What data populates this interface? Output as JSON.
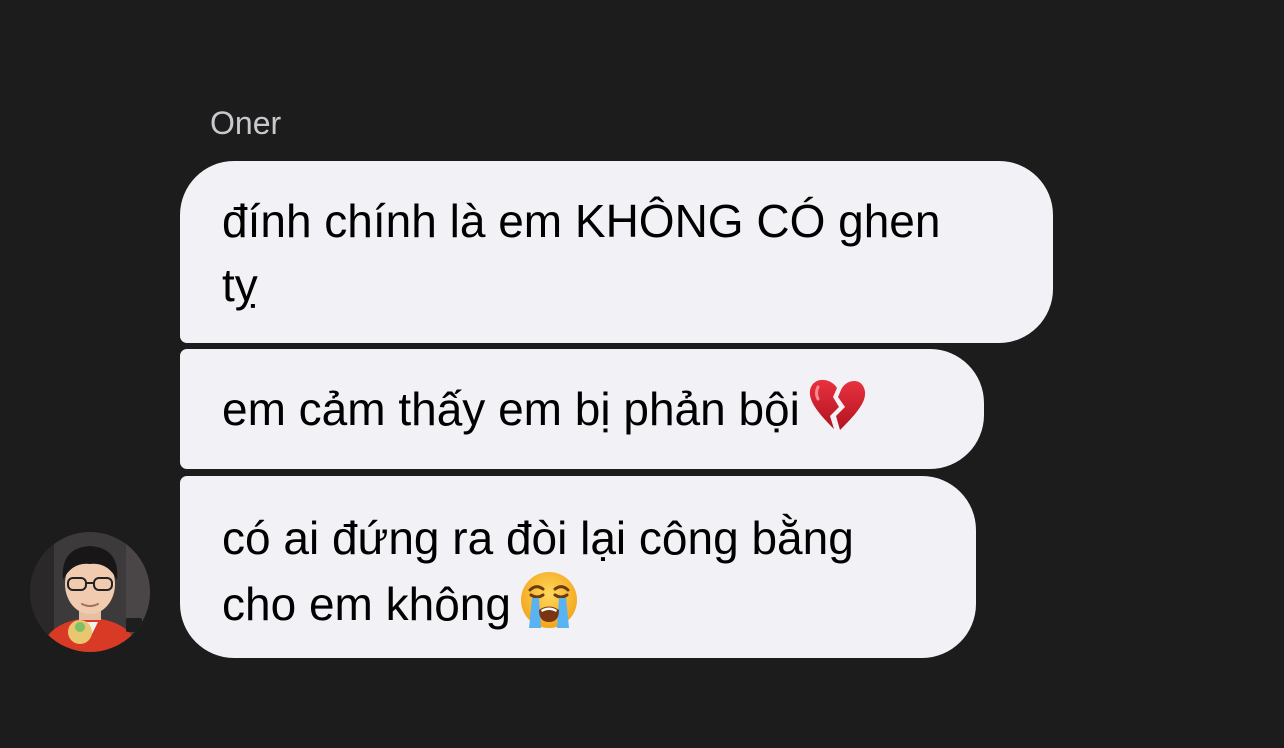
{
  "conversation": {
    "sender_name": "Oner",
    "messages": [
      {
        "lines": [
          "đính chính là em KHÔNG CÓ ghen",
          "tỵ"
        ]
      },
      {
        "lines": [
          "em cảm thấy em bị phản bội"
        ],
        "emoji": "broken-heart-icon"
      },
      {
        "lines": [
          "có ai đứng ra đòi lại công bằng",
          "cho em không"
        ],
        "emoji": "loudly-crying-face-icon"
      }
    ]
  },
  "colors": {
    "background": "#1c1c1d",
    "bubble": "#f2f1f6",
    "bubble_text": "#000000",
    "sender_name": "#c9c9cd"
  }
}
